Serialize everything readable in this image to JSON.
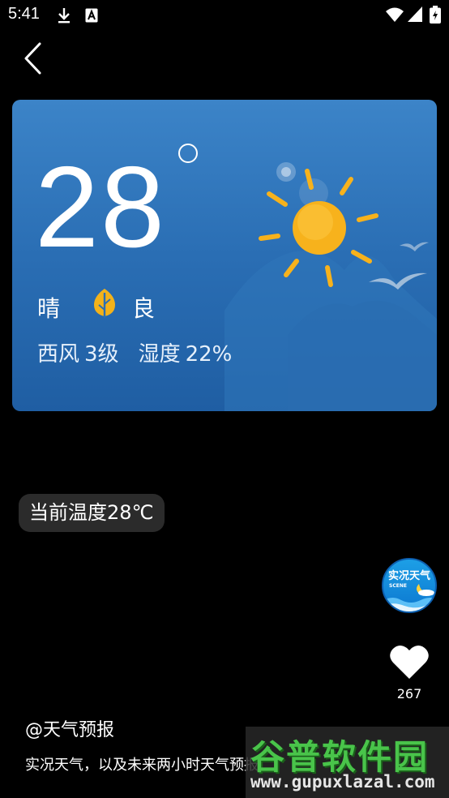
{
  "status_bar": {
    "time": "5:41",
    "icons": [
      "download-icon",
      "a-text-icon",
      "wifi-icon",
      "signal-icon",
      "battery-icon"
    ]
  },
  "nav": {
    "back_icon": "chevron-left-icon"
  },
  "weather": {
    "temperature": "28",
    "condition": "晴",
    "air_quality": "良",
    "wind_label": "西风",
    "wind_level": "3级",
    "humidity_label": "湿度",
    "humidity_value": "22%"
  },
  "temp_pill": "当前温度28℃",
  "scene": {
    "title": "实况天气",
    "subtitle": "SCENE"
  },
  "likes": {
    "count": "267"
  },
  "author": "@天气预报",
  "caption": "实况天气，以及未来两小时天气预报",
  "watermark": {
    "title": "谷普软件园",
    "url": "www.gupuxlazal.com"
  },
  "colors": {
    "card_top": "#3c84c8",
    "card_bottom": "#1f5ea3",
    "sun": "#f7b21c",
    "leaf": "#f3b21a",
    "pill_bg": "#2b2b2b",
    "watermark_green": "#49c44a"
  }
}
